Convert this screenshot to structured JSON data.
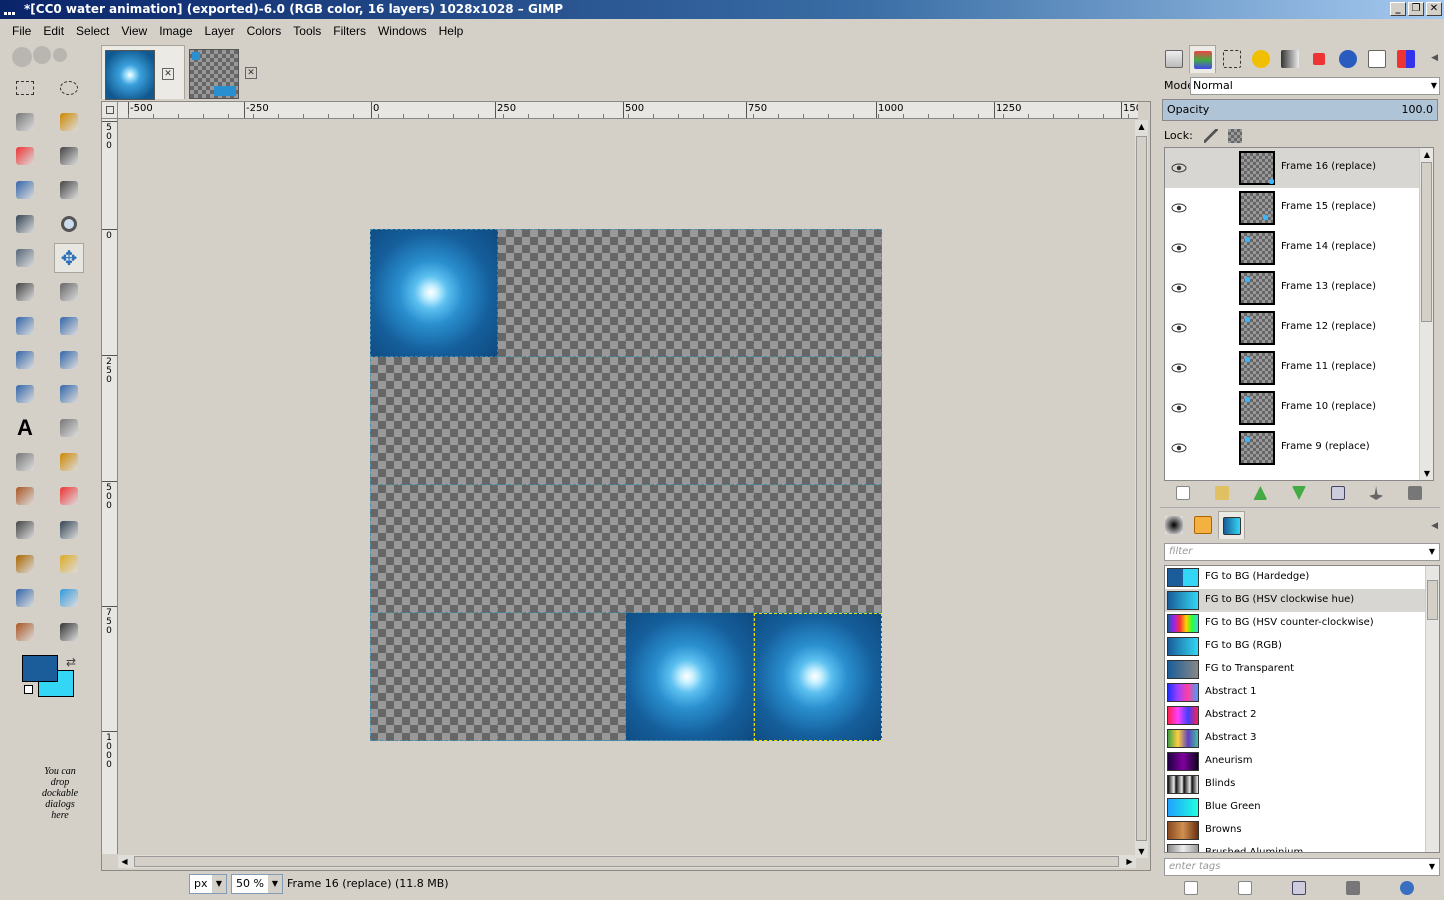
{
  "window": {
    "title": "*[CC0 water animation] (exported)-6.0 (RGB color, 16 layers) 1028x1028 – GIMP",
    "buttons": {
      "minimize": "_",
      "maximize": "❐",
      "close": "✕"
    }
  },
  "menu": [
    "File",
    "Edit",
    "Select",
    "View",
    "Image",
    "Layer",
    "Colors",
    "Tools",
    "Filters",
    "Windows",
    "Help"
  ],
  "toolbox": {
    "tools": [
      "rect-select-icon",
      "ellipse-select-icon",
      "free-select-icon",
      "fuzzy-select-icon",
      "color-select-icon",
      "scissors-icon",
      "foreground-select-icon",
      "paths-icon",
      "color-picker-icon",
      "zoom-icon",
      "measure-icon",
      "move-icon",
      "align-icon",
      "crop-icon",
      "rotate-icon",
      "scale-icon",
      "shear-icon",
      "perspective-icon",
      "flip-icon",
      "cage-icon",
      "text-icon",
      "bucket-fill-icon",
      "blend-icon",
      "pencil-icon",
      "paintbrush-icon",
      "eraser-icon",
      "airbrush-icon",
      "ink-icon",
      "clone-icon",
      "heal-icon",
      "perspective-clone-icon",
      "blur-icon",
      "smudge-icon",
      "dodge-burn-icon"
    ],
    "active_tool": "move-icon",
    "fg_color": "#1a5d9a",
    "bg_color": "#33d6f5",
    "drop_hint": "You can drop dockable dialogs here"
  },
  "image_tabs": [
    {
      "name": "water-frame-thumb",
      "close": "✕"
    },
    {
      "name": "sprite-sheet-thumb",
      "close": "✕"
    }
  ],
  "rulers": {
    "h_labels": [
      "-500",
      "-250",
      "0",
      "250",
      "500",
      "750",
      "1000",
      "1250",
      "150"
    ],
    "v_labels": [
      "500",
      "0",
      "250",
      "500",
      "750",
      "1000"
    ]
  },
  "status": {
    "unit": "px",
    "zoom": "50 %",
    "text": "Frame 16 (replace) (11.8 MB)"
  },
  "layers_panel": {
    "mode_label": "Mode:",
    "mode_value": "Normal",
    "opacity_label": "Opacity",
    "opacity_value": "100.0",
    "lock_label": "Lock:",
    "layers": [
      {
        "name": "Frame 16 (replace)",
        "selected": true
      },
      {
        "name": "Frame 15 (replace)",
        "selected": false
      },
      {
        "name": "Frame 14 (replace)",
        "selected": false
      },
      {
        "name": "Frame 13 (replace)",
        "selected": false
      },
      {
        "name": "Frame 12 (replace)",
        "selected": false
      },
      {
        "name": "Frame 11 (replace)",
        "selected": false
      },
      {
        "name": "Frame 10 (replace)",
        "selected": false
      },
      {
        "name": "Frame 9 (replace)",
        "selected": false
      }
    ]
  },
  "gradients_panel": {
    "filter_placeholder": "filter",
    "tags_placeholder": "enter tags",
    "gradients": [
      {
        "name": "FG to BG (Hardedge)",
        "selected": false,
        "swatch": "linear-gradient(to right,#1a5d9a 50%,#33d6f5 50%)"
      },
      {
        "name": "FG to BG (HSV clockwise hue)",
        "selected": true,
        "swatch": "linear-gradient(to right,#1a5d9a,#33d6f5)"
      },
      {
        "name": "FG to BG (HSV counter-clockwise)",
        "selected": false,
        "swatch": "linear-gradient(to right,#1a5d9a,#a020f0,#ff3030,#ffd000,#30ff30,#33d6f5)"
      },
      {
        "name": "FG to BG (RGB)",
        "selected": false,
        "swatch": "linear-gradient(to right,#1a5d9a,#33d6f5)"
      },
      {
        "name": "FG to Transparent",
        "selected": false,
        "swatch": "linear-gradient(to right,#1a5d9a,#888)"
      },
      {
        "name": "Abstract 1",
        "selected": false,
        "swatch": "linear-gradient(to right,#2030ff,#a040ff,#ff40a0,#40a0ff)"
      },
      {
        "name": "Abstract 2",
        "selected": false,
        "swatch": "linear-gradient(to right,#ff2050,#ff40ff,#4040ff,#ff2050)"
      },
      {
        "name": "Abstract 3",
        "selected": false,
        "swatch": "linear-gradient(to right,#40a040,#ffd040,#6040c0,#40c0a0)"
      },
      {
        "name": "Aneurism",
        "selected": false,
        "swatch": "linear-gradient(to right,#200040,#8000a0,#100020)"
      },
      {
        "name": "Blinds",
        "selected": false,
        "swatch": "repeating-linear-gradient(to right,#111 0,#eee 6px,#111 8px)"
      },
      {
        "name": "Blue Green",
        "selected": false,
        "swatch": "linear-gradient(to right,#20a0ff,#20ffe0)"
      },
      {
        "name": "Browns",
        "selected": false,
        "swatch": "linear-gradient(to right,#8a4a20,#d09050,#6a3010)"
      },
      {
        "name": "Brushed Aluminium",
        "selected": false,
        "swatch": "linear-gradient(to right,#888,#eee,#999)"
      }
    ]
  }
}
